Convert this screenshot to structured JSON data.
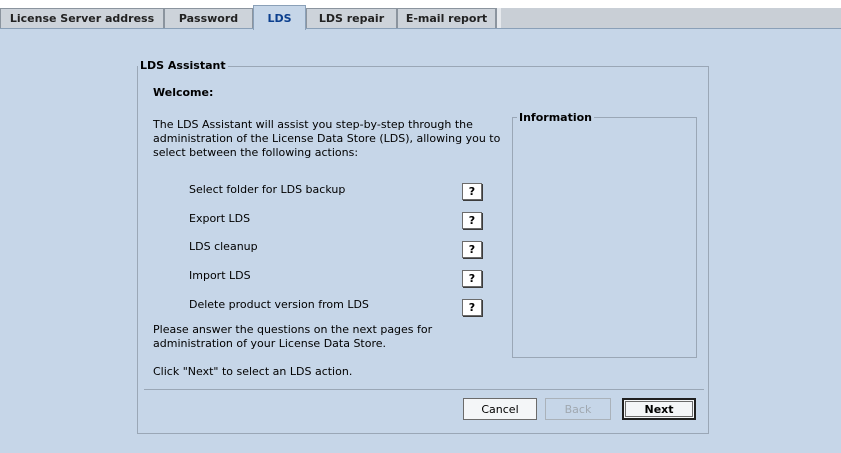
{
  "tabs": [
    {
      "label": "License Server address"
    },
    {
      "label": "Password"
    },
    {
      "label": "LDS"
    },
    {
      "label": "LDS repair"
    },
    {
      "label": "E-mail report"
    }
  ],
  "active_tab": "LDS",
  "panel": {
    "title": "LDS Assistant",
    "welcome": "Welcome:",
    "intro": "The LDS Assistant will assist you step-by-step through the administration of the License Data Store (LDS), allowing you to select between the following actions:",
    "actions": [
      {
        "label": "Select folder for LDS backup",
        "help": "?"
      },
      {
        "label": "Export LDS",
        "help": "?"
      },
      {
        "label": "LDS cleanup",
        "help": "?"
      },
      {
        "label": "Import LDS",
        "help": "?"
      },
      {
        "label": "Delete product version from LDS",
        "help": "?"
      }
    ],
    "footer_note": "Please answer the questions on the next pages for administration of your License Data Store.",
    "next_hint": "Click \"Next\" to select an LDS action.",
    "info_title": "Information"
  },
  "buttons": {
    "cancel": "Cancel",
    "back": "Back",
    "next": "Next"
  }
}
